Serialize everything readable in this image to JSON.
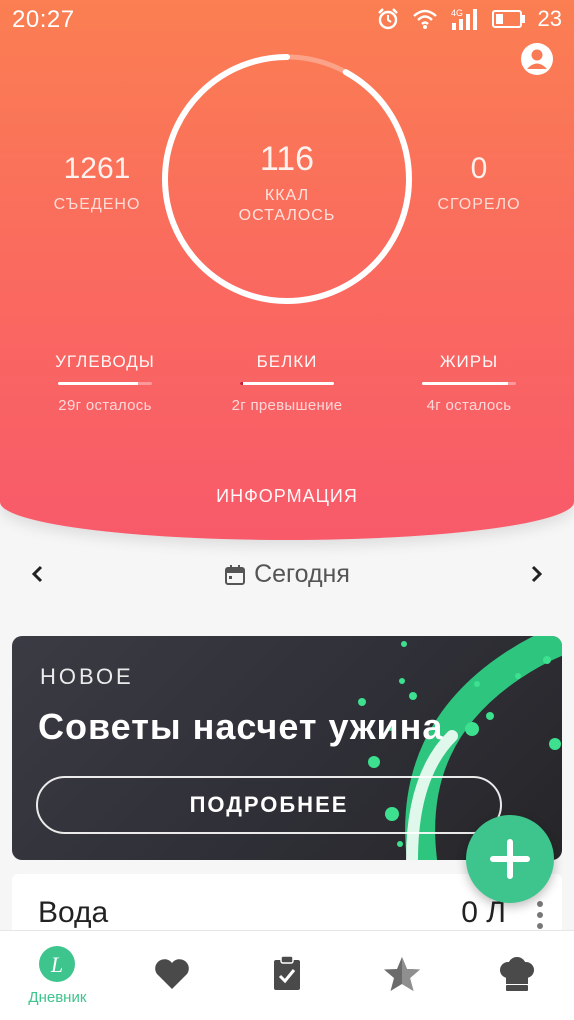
{
  "status_bar": {
    "time": "20:27",
    "battery_level": "23"
  },
  "summary": {
    "eaten": {
      "value": "1261",
      "label": "СЪЕДЕНО"
    },
    "remaining": {
      "value": "116",
      "label_line1": "ККАЛ",
      "label_line2": "ОСТАЛОСЬ"
    },
    "burned": {
      "value": "0",
      "label": "СГОРЕЛО"
    },
    "ring_progress": 0.92
  },
  "macros": [
    {
      "name": "УГЛЕВОДЫ",
      "status": "29г осталось",
      "progress": 0.85,
      "over": false
    },
    {
      "name": "БЕЛКИ",
      "status": "2г превышение",
      "progress": 1.0,
      "over": true
    },
    {
      "name": "ЖИРЫ",
      "status": "4г осталось",
      "progress": 0.92,
      "over": false
    }
  ],
  "info_button": "ИНФОРМАЦИЯ",
  "date_nav": {
    "label": "Сегодня"
  },
  "promo": {
    "tag": "НОВОЕ",
    "title": "Советы насчет ужина",
    "button": "ПОДРОБНЕЕ"
  },
  "water": {
    "label": "Вода",
    "value": "0 Л"
  },
  "bottom_nav": [
    {
      "label": "Дневник",
      "icon": "diary-icon",
      "active": true
    },
    {
      "label": "",
      "icon": "heart-icon",
      "active": false
    },
    {
      "label": "",
      "icon": "clipboard-icon",
      "active": false
    },
    {
      "label": "",
      "icon": "star-icon",
      "active": false
    },
    {
      "label": "",
      "icon": "chef-hat-icon",
      "active": false
    }
  ],
  "colors": {
    "accent": "#3ec48d",
    "header_top": "#fb7f52",
    "header_bottom": "#f85a6a",
    "promo_bg": "#2f2f37"
  }
}
